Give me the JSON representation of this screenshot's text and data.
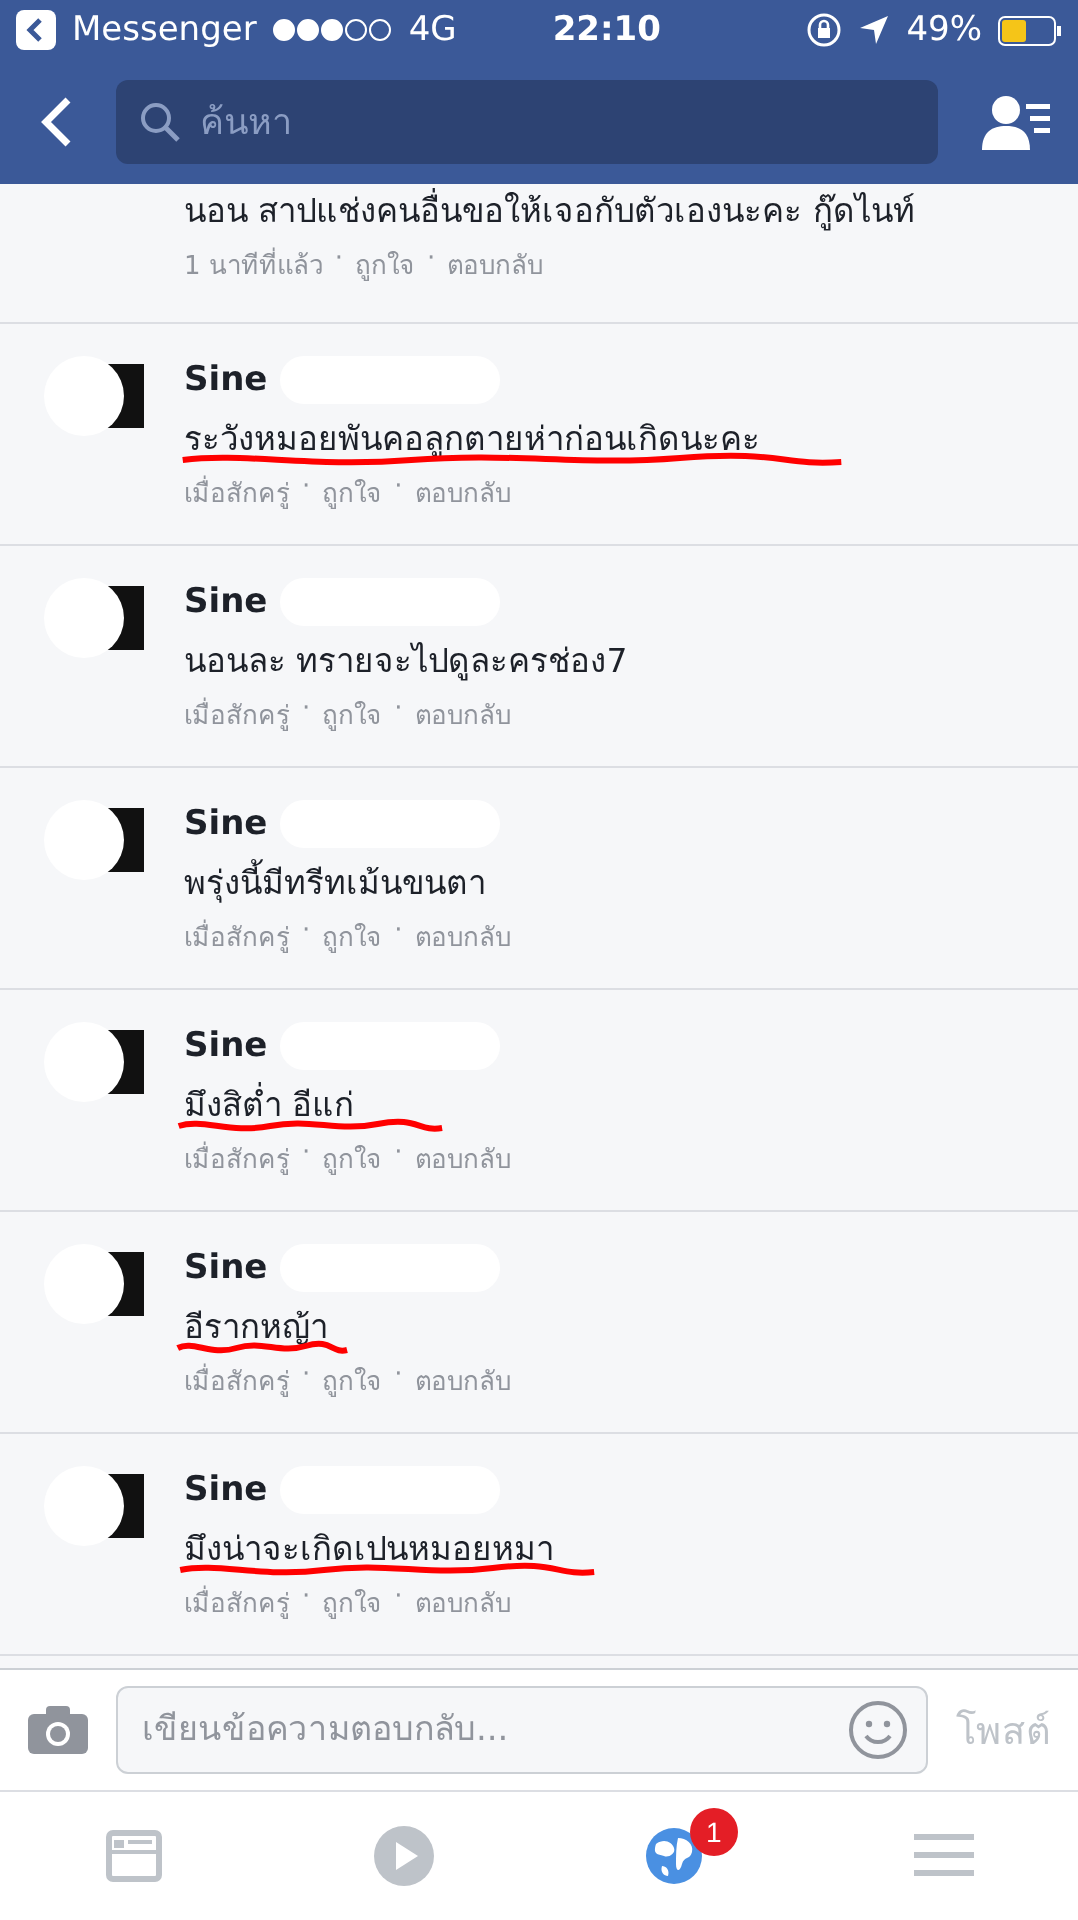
{
  "status_bar": {
    "back_app": "Messenger",
    "carrier": "4G",
    "time": "22:10",
    "battery": "49%"
  },
  "nav": {
    "search_placeholder": "ค้นหา"
  },
  "comments": [
    {
      "partial": true,
      "text": "นอน สาปแช่งคนอื่นขอให้เจอกับตัวเองนะคะ กู๊ดไนท์",
      "meta": [
        "1 นาทีที่แล้ว",
        "ถูกใจ",
        "ตอบกลับ"
      ],
      "underlined": false
    },
    {
      "partial": false,
      "name": "Sine",
      "text": "ระวังหมอยพันคอลูกตายห่าก่อนเกิดนะคะ",
      "meta": [
        "เมื่อสักครู่",
        "ถูกใจ",
        "ตอบกลับ"
      ],
      "underlined": true
    },
    {
      "partial": false,
      "name": "Sine",
      "text": "นอนละ ทรายจะไปดูละครช่อง7",
      "meta": [
        "เมื่อสักครู่",
        "ถูกใจ",
        "ตอบกลับ"
      ],
      "underlined": false
    },
    {
      "partial": false,
      "name": "Sine",
      "text": "พรุ่งนี้มีทรีทเม้นขนตา",
      "meta": [
        "เมื่อสักครู่",
        "ถูกใจ",
        "ตอบกลับ"
      ],
      "underlined": false
    },
    {
      "partial": false,
      "name": "Sine",
      "text": "มึงสิต่ำ อีแก่",
      "meta": [
        "เมื่อสักครู่",
        "ถูกใจ",
        "ตอบกลับ"
      ],
      "underlined": true
    },
    {
      "partial": false,
      "name": "Sine",
      "text": "อีรากหญ้า",
      "meta": [
        "เมื่อสักครู่",
        "ถูกใจ",
        "ตอบกลับ"
      ],
      "underlined": true
    },
    {
      "partial": false,
      "name": "Sine",
      "text": "มึงน่าจะเกิดเปนหมอยหมา",
      "meta": [
        "เมื่อสักครู่",
        "ถูกใจ",
        "ตอบกลับ"
      ],
      "underlined": true
    }
  ],
  "meta_separator": "·",
  "composer": {
    "placeholder": "เขียนข้อความตอบกลับ...",
    "post": "โพสต์"
  },
  "tab_bar": [
    {
      "kind": "feed"
    },
    {
      "kind": "video"
    },
    {
      "kind": "globe",
      "badge": "1"
    },
    {
      "kind": "menu"
    }
  ]
}
